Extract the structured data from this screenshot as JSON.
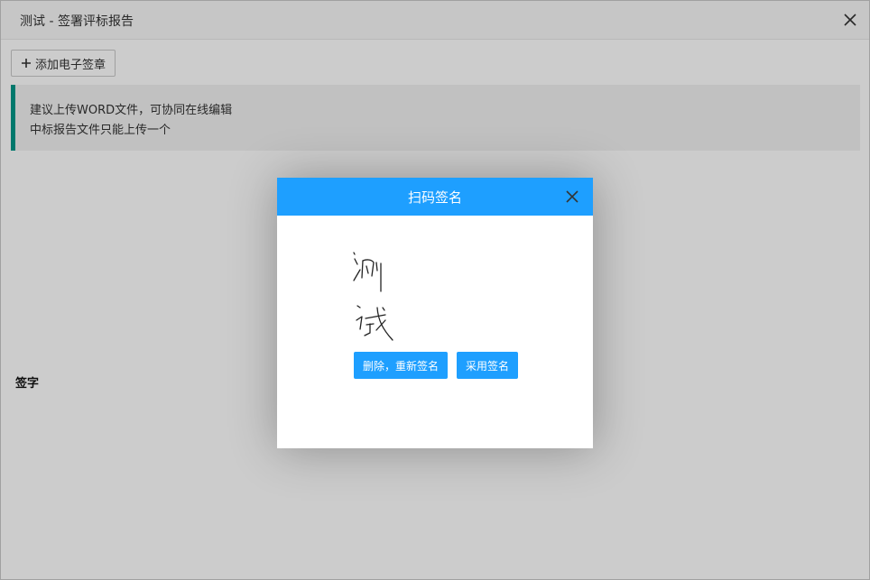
{
  "window": {
    "title": "测试 - 签署评标报告",
    "close_icon": "close-icon"
  },
  "toolbar": {
    "add_label": "添加电子签章",
    "add_icon": "plus-icon"
  },
  "notice": {
    "line1": "建议上传WORD文件，可协同在线编辑",
    "line2": "中标报告文件只能上传一个",
    "accent": "#009688"
  },
  "form": {
    "sign_label": "签字"
  },
  "modal": {
    "title": "扫码签名",
    "header_color": "#1e9fff",
    "close_icon": "close-icon",
    "signature_text": "测试",
    "redo_label": "删除，重新签名",
    "use_label": "采用签名"
  }
}
